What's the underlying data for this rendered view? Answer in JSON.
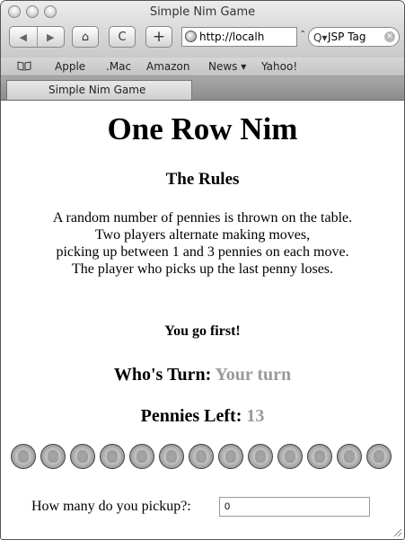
{
  "window": {
    "title": "Simple Nim Game"
  },
  "toolbar": {
    "back_glyph": "◀",
    "forward_glyph": "▶",
    "home_glyph": "⌂",
    "reload_glyph": "C",
    "add_glyph": "+",
    "url": "http://localh",
    "url_menu_glyph": "⌃",
    "search_glyph": "Q▾",
    "search_text": "JSP Tag"
  },
  "bookmarks": [
    "Apple",
    ".Mac",
    "Amazon",
    "News ▾",
    "Yahoo!"
  ],
  "tab": {
    "label": "Simple Nim Game"
  },
  "page": {
    "heading": "One Row Nim",
    "rules_heading": "The Rules",
    "rules_lines": [
      "A random number of pennies is thrown on the table.",
      "Two players alternate making moves,",
      "picking up between 1 and 3 pennies on each move.",
      "The player who picks up the last penny loses."
    ],
    "first_move": "You go first!",
    "turn_label": "Who's Turn: ",
    "turn_value": "Your turn",
    "pennies_label": "Pennies Left: ",
    "pennies_value": "13",
    "penny_count": 13,
    "pickup_prompt": "How many do you pickup?:",
    "pickup_value": "0"
  },
  "colors": {
    "status_text": "#9a9a9a"
  }
}
